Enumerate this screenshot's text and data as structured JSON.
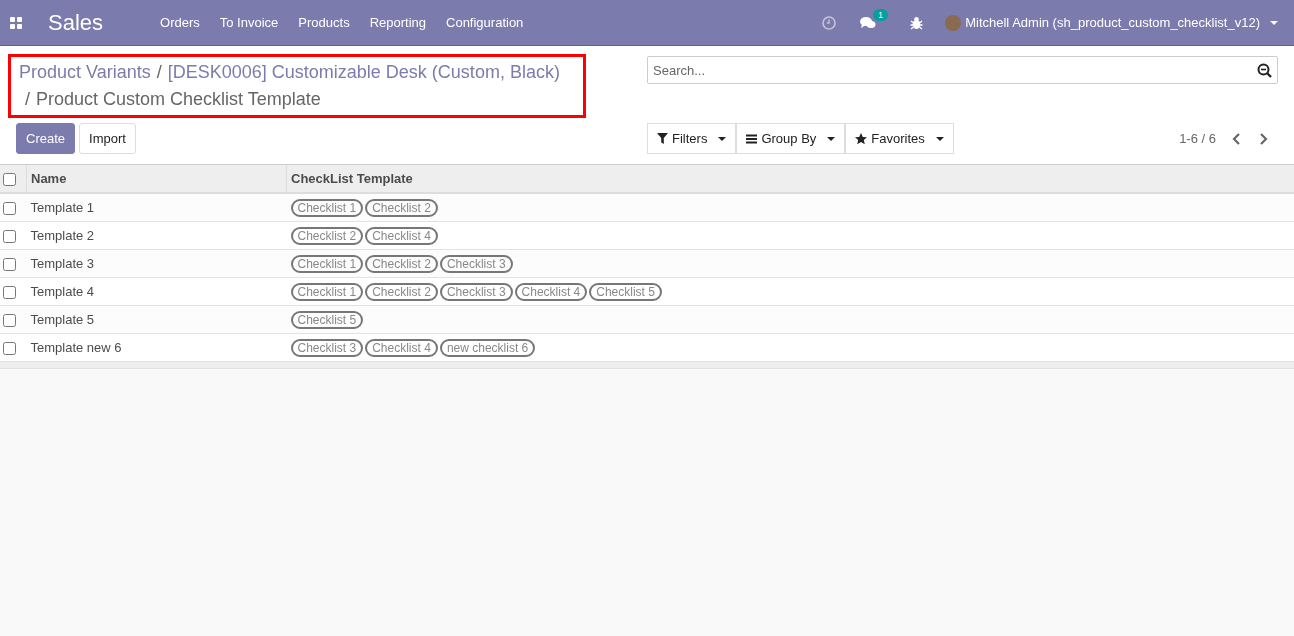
{
  "navbar": {
    "app_title": "Sales",
    "menu": [
      "Orders",
      "To Invoice",
      "Products",
      "Reporting",
      "Configuration"
    ],
    "messages_badge": "1",
    "user": "Mitchell Admin (sh_product_custom_checklist_v12)"
  },
  "breadcrumb": {
    "links": [
      "Product Variants",
      "[DESK0006] Customizable Desk (Custom, Black)"
    ],
    "separators": [
      "/",
      "/"
    ],
    "current": "Product Custom Checklist Template",
    "highlighted": true
  },
  "buttons": [
    "Create",
    "Import"
  ],
  "search": {
    "placeholder": "Search..."
  },
  "filters": [
    {
      "kind": "filter",
      "label": "Filters"
    },
    {
      "kind": "group",
      "label": "Group By"
    },
    {
      "kind": "favorite",
      "label": "Favorites"
    }
  ],
  "pager": "1-6 / 6",
  "table": {
    "columns": [
      "Name",
      "CheckList Template"
    ],
    "all_checked": false,
    "rows": [
      {
        "checked": false,
        "name": "Template 1",
        "tags": [
          "Checklist 1",
          "Checklist 2"
        ]
      },
      {
        "checked": false,
        "name": "Template 2",
        "tags": [
          "Checklist 2",
          "Checklist 4"
        ]
      },
      {
        "checked": false,
        "name": "Template 3",
        "tags": [
          "Checklist 1",
          "Checklist 2",
          "Checklist 3"
        ]
      },
      {
        "checked": false,
        "name": "Template 4",
        "tags": [
          "Checklist 1",
          "Checklist 2",
          "Checklist 3",
          "Checklist 4",
          "Checklist 5"
        ]
      },
      {
        "checked": false,
        "name": "Template 5",
        "tags": [
          "Checklist 5"
        ]
      },
      {
        "checked": false,
        "name": "Template new 6",
        "tags": [
          "Checklist 3",
          "Checklist 4",
          "new checklist 6"
        ]
      }
    ]
  }
}
